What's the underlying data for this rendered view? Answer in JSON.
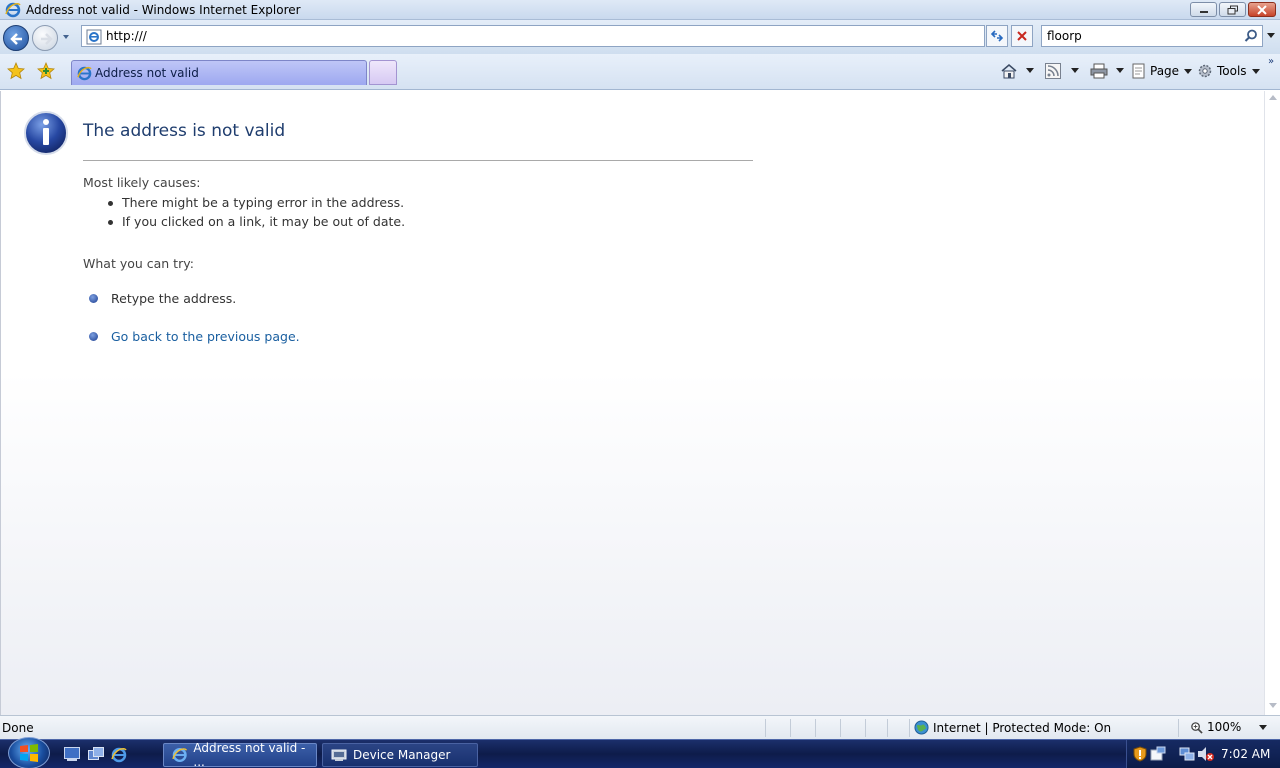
{
  "window": {
    "title": "Address not valid - Windows Internet Explorer"
  },
  "navigation": {
    "address": "http:///",
    "search_value": "floorp"
  },
  "tabs": [
    {
      "label": "Address not valid",
      "active": true
    }
  ],
  "commands": {
    "page_label": "Page",
    "tools_label": "Tools"
  },
  "error_page": {
    "title": "The address is not valid",
    "causes_heading": "Most likely causes:",
    "causes": [
      "There might be a typing error in the address.",
      "If you clicked on a link, it may be out of date."
    ],
    "try_heading": "What you can try:",
    "try_items": [
      {
        "text": "Retype the address.",
        "link": false
      },
      {
        "text": "Go back to the previous page.",
        "link": true
      }
    ]
  },
  "status": {
    "text": "Done",
    "zone": "Internet | Protected Mode: On",
    "zoom": "100%"
  },
  "taskbar": {
    "tasks": [
      {
        "label": "Address not valid - ...",
        "active": true
      },
      {
        "label": "Device Manager",
        "active": false
      }
    ],
    "clock": "7:02 AM"
  },
  "colors": {
    "accent": "#1f3d6e",
    "link": "#1a5fa0",
    "taskbar": "#0e1c4a"
  }
}
